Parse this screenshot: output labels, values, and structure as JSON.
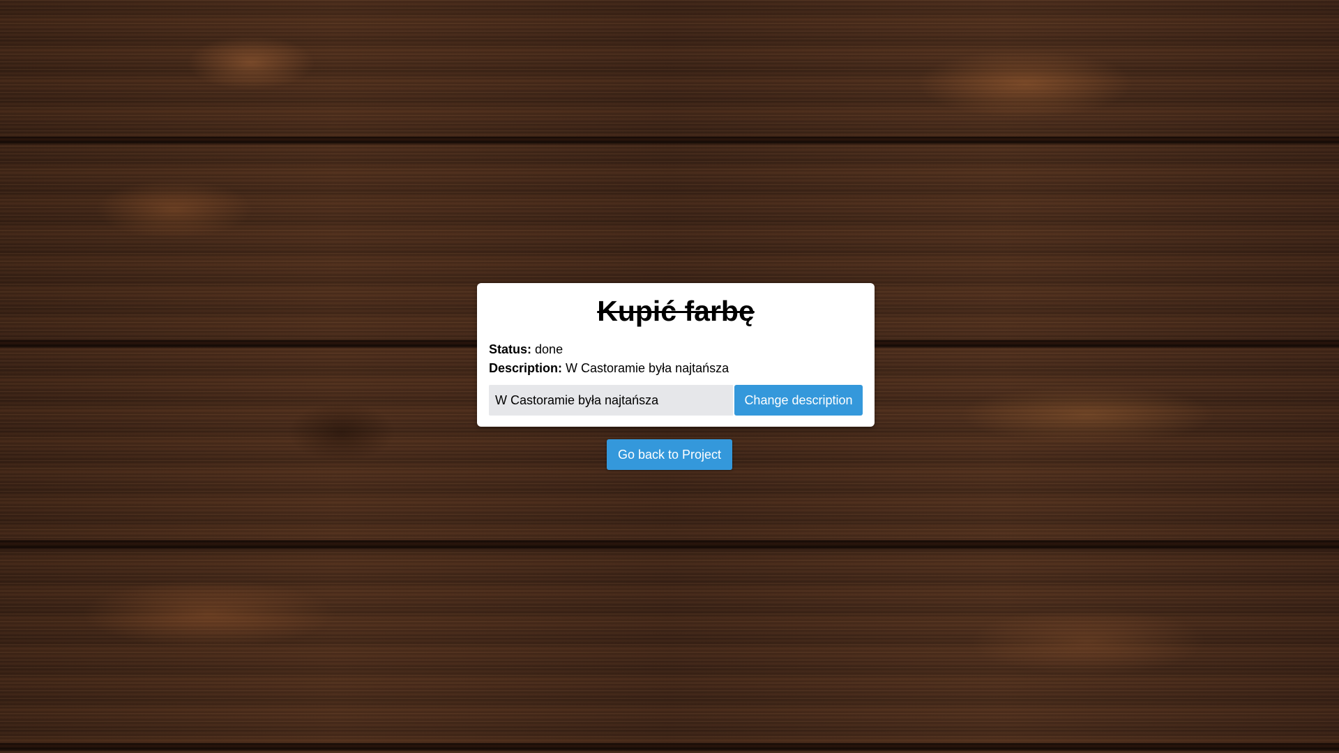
{
  "task": {
    "title": "Kupić farbę",
    "status_label": "Status:",
    "status_value": "done",
    "description_label": "Description:",
    "description_value": "W Castoramie była najtańsza"
  },
  "edit": {
    "input_value": "W Castoramie była najtańsza",
    "change_label": "Change description"
  },
  "nav": {
    "back_label": "Go back to Project"
  },
  "colors": {
    "accent": "#3498db",
    "card_bg": "#ffffff",
    "input_bg": "#e6e7ea"
  }
}
